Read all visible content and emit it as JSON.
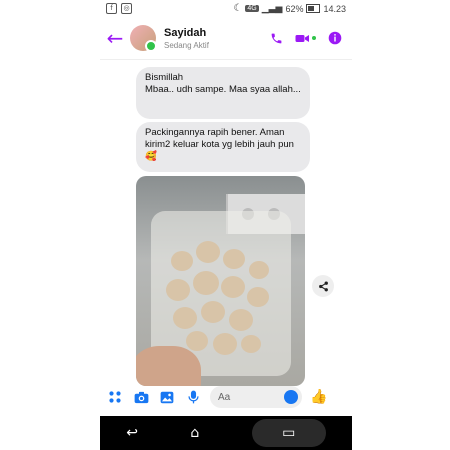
{
  "status_bar": {
    "network": "4G",
    "battery": "62%",
    "time": "14.23"
  },
  "header": {
    "name": "Sayidah",
    "status": "Sedang Aktif"
  },
  "messages": [
    {
      "text": "Bismillah\nMbaa.. udh sampe. Maa syaa allah..."
    },
    {
      "text": "Packingannya rapih bener. Aman kirim2 keluar kota yg lebih jauh pun 🥰"
    }
  ],
  "composer": {
    "placeholder": "Aa"
  },
  "colors": {
    "accent": "#9b19f5",
    "messenger_blue": "#1877f2",
    "bubble_gray": "#e9e9eb"
  },
  "icons": {
    "back": "arrow-left-icon",
    "call": "phone-icon",
    "video": "video-camera-icon",
    "info": "info-icon",
    "share": "share-icon",
    "menu": "dots-grid-icon",
    "camera": "camera-icon",
    "gallery": "image-icon",
    "mic": "microphone-icon",
    "emoji": "smiley-icon",
    "like": "thumbs-up-icon"
  }
}
